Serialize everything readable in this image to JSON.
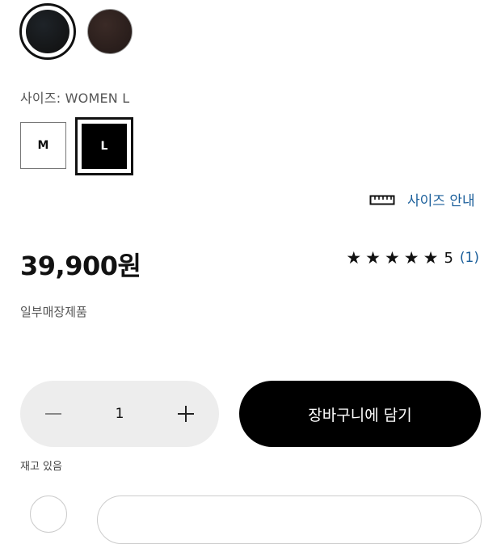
{
  "colors": {
    "swatches": [
      {
        "name": "black",
        "hex": "#1e2328",
        "selected": true
      },
      {
        "name": "brown",
        "hex": "#3a2a26",
        "selected": false
      }
    ],
    "link": "#1a5e9a"
  },
  "size": {
    "label": "사이즈: WOMEN L",
    "options": [
      "M",
      "L"
    ],
    "selected": "L",
    "guide_label": "사이즈 안내"
  },
  "price": "39,900원",
  "rating": {
    "stars": "★★★★★",
    "score": "5",
    "count": "(1)"
  },
  "notice": "일부매장제품",
  "quantity": {
    "minus": "−",
    "value": "1",
    "plus": "+"
  },
  "cart_button": "장바구니에 담기",
  "stock": "재고 있음"
}
